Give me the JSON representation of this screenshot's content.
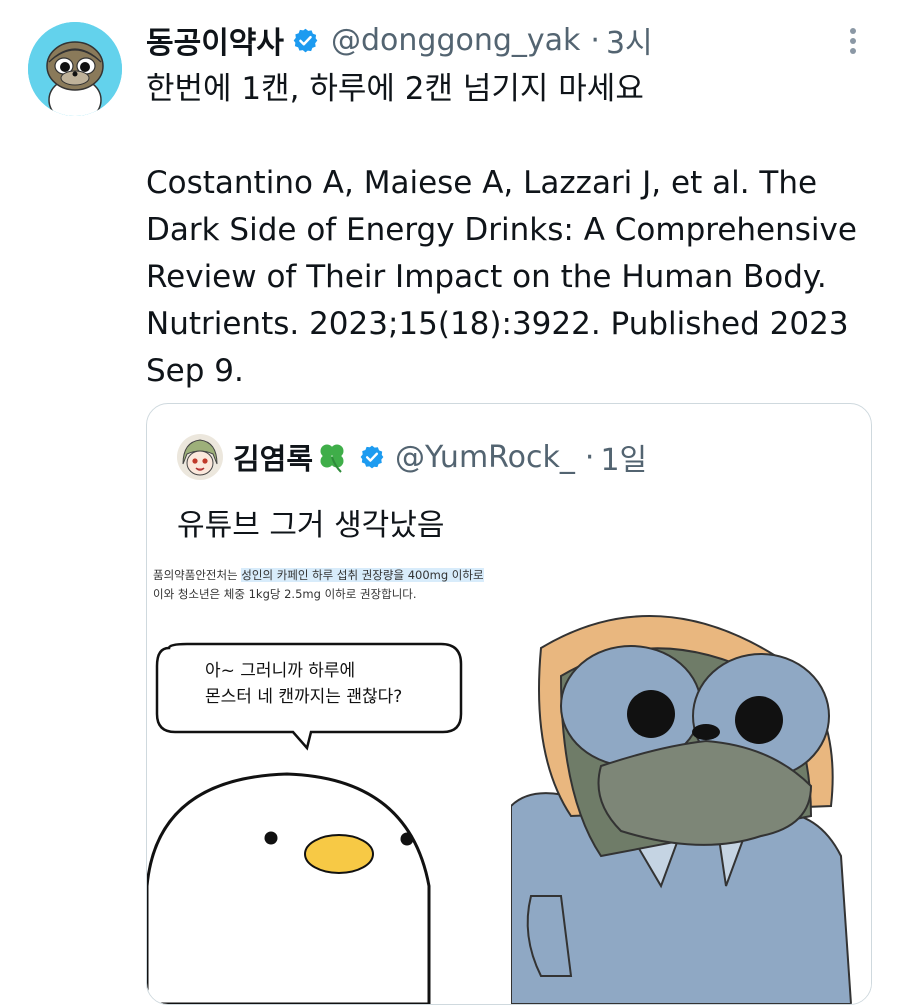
{
  "tweet": {
    "author_name": "동공이약사",
    "handle": "@donggong_yak",
    "separator": "·",
    "time": "3시",
    "text_line1": "한번에 1캔, 하루에 2캔 넘기지 마세요",
    "text_citation": "Costantino A, Maiese A, Lazzari J, et al. The Dark Side of Energy Drinks: A Comprehensive Review of Their Impact on the Human Body. Nutrients. 2023;15(18):3922. Published 2023 Sep 9."
  },
  "quote": {
    "author_name": "김염록",
    "handle": "@YumRock_",
    "separator": "·",
    "time": "1일",
    "text": "유튜브 그거 생각났음",
    "image_left": {
      "caption_pre": "품의약품안전처는 ",
      "caption_highlight": "성인의 카페인 하루 섭취 권장량을 400mg 이하로",
      "caption_line2": "이와 청소년은 체중 1kg당 2.5mg 이하로 권장합니다.",
      "speech_line1": "아~ 그러니까 하루에",
      "speech_line2": "몬스터 네 캔까지는 괜찮다?"
    }
  },
  "colors": {
    "verified": "#1d9bf0",
    "secondary_text": "#536471",
    "avatar_bg": "#63d2ec",
    "highlight": "#d8ecfb"
  },
  "icons": [
    "verified-badge-icon",
    "more-options-icon",
    "clover-emoji-icon"
  ]
}
